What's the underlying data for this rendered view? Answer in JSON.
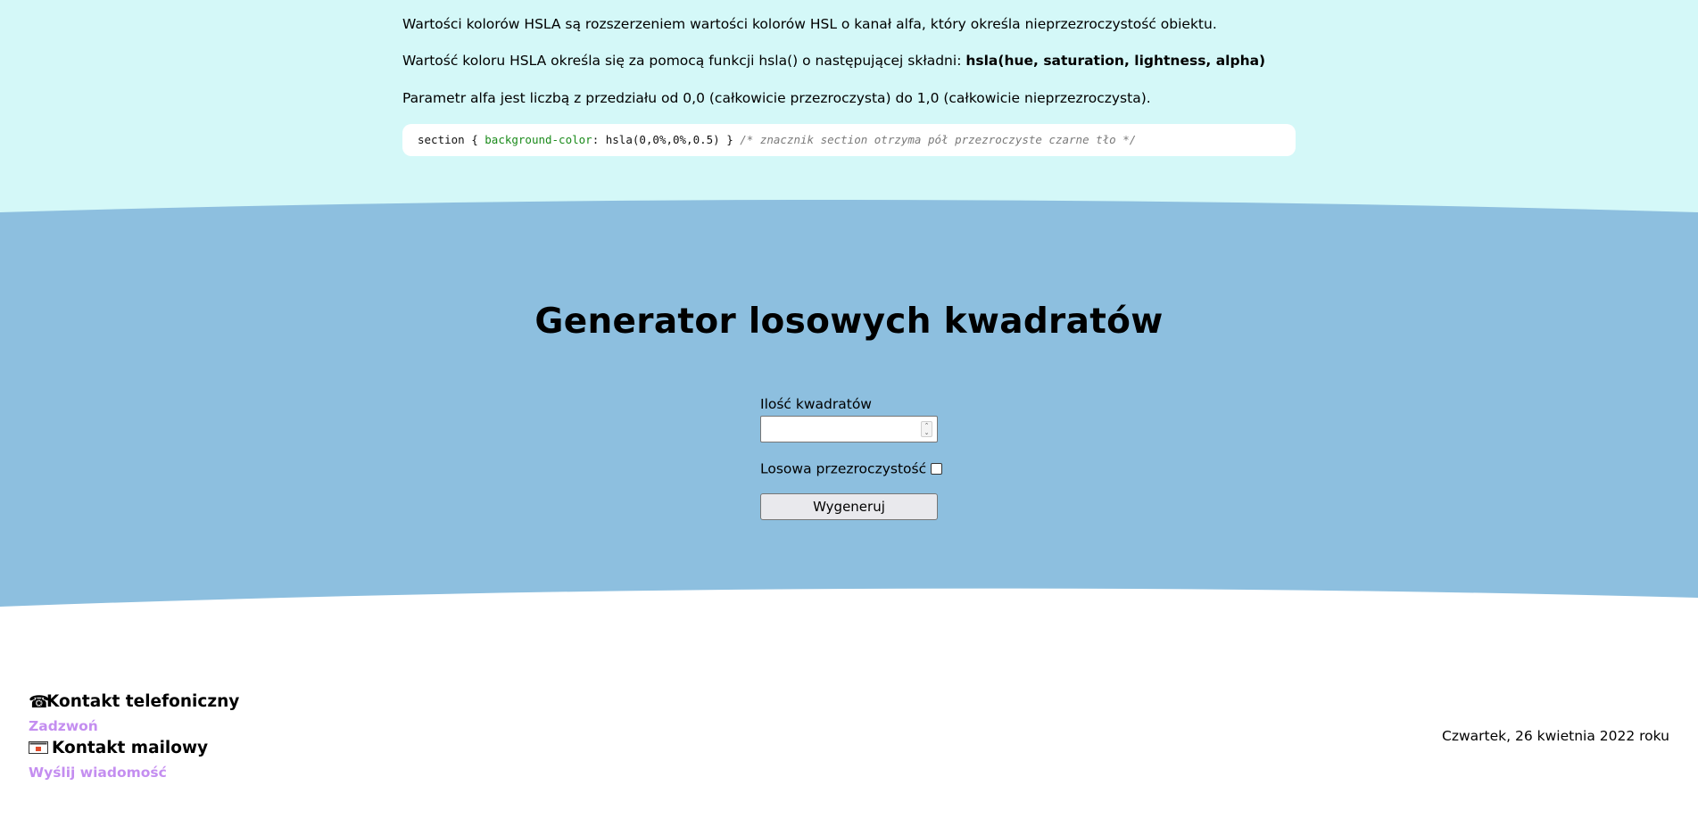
{
  "article": {
    "para1": "Wartości kolorów HSLA są rozszerzeniem wartości kolorów HSL o kanał alfa, który określa nieprzezroczystość obiektu.",
    "para2_text": "Wartość koloru HSLA określa się za pomocą funkcji hsla() o następującej składni: ",
    "para2_bold": "hsla(hue, saturation, lightness, alpha)",
    "para3": "Parametr alfa jest liczbą z przedziału od 0,0 (całkowicie przezroczysta) do 1,0 (całkowicie nieprzezroczysta).",
    "code": {
      "selector": "section { ",
      "property": "background-color",
      "value": ": hsla(0,0%,0%,0.5) } ",
      "comment": "/* znacznik section otrzyma pół przezroczyste czarne tło */"
    }
  },
  "generator": {
    "title": "Generator losowych kwadratów",
    "count_label": "Ilość kwadratów",
    "count_value": "",
    "opacity_label": "Losowa przezroczystość",
    "opacity_checked": false,
    "button_label": "Wygeneruj"
  },
  "footer": {
    "phone_heading": "Kontakt telefoniczny",
    "phone_link": "Zadzwoń",
    "mail_heading": "Kontakt mailowy",
    "mail_link": "Wyślij wiadomość",
    "date": "Czwartek, 26 kwietnia 2022 roku"
  },
  "icons": {
    "phone": "telephone-icon",
    "mail": "envelope-icon"
  },
  "colors": {
    "top_background": "#d4f8f8",
    "generator_background": "#8dbfdf",
    "link": "#c48ef0",
    "code_property": "#1a8a1a"
  }
}
